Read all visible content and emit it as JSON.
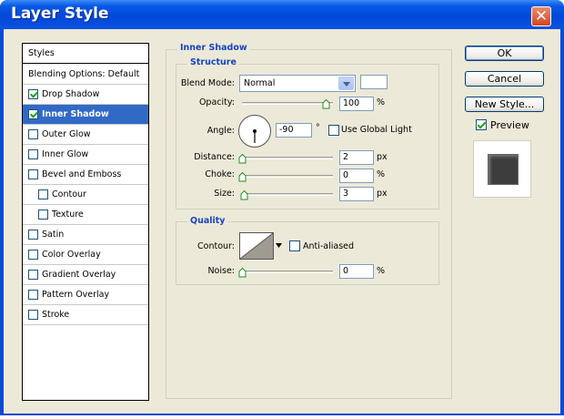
{
  "window": {
    "title": "Layer Style",
    "close_glyph": "✕"
  },
  "sidebar": {
    "header": "Styles",
    "items": [
      {
        "label": "Blending Options: Default",
        "checkbox": false,
        "checked": false,
        "indent": false
      },
      {
        "label": "Drop Shadow",
        "checkbox": true,
        "checked": true,
        "indent": false
      },
      {
        "label": "Inner Shadow",
        "checkbox": true,
        "checked": true,
        "indent": false,
        "selected": true
      },
      {
        "label": "Outer Glow",
        "checkbox": true,
        "checked": false,
        "indent": false
      },
      {
        "label": "Inner Glow",
        "checkbox": true,
        "checked": false,
        "indent": false
      },
      {
        "label": "Bevel and Emboss",
        "checkbox": true,
        "checked": false,
        "indent": false
      },
      {
        "label": "Contour",
        "checkbox": true,
        "checked": false,
        "indent": true
      },
      {
        "label": "Texture",
        "checkbox": true,
        "checked": false,
        "indent": true
      },
      {
        "label": "Satin",
        "checkbox": true,
        "checked": false,
        "indent": false
      },
      {
        "label": "Color Overlay",
        "checkbox": true,
        "checked": false,
        "indent": false
      },
      {
        "label": "Gradient Overlay",
        "checkbox": true,
        "checked": false,
        "indent": false
      },
      {
        "label": "Pattern Overlay",
        "checkbox": true,
        "checked": false,
        "indent": false
      },
      {
        "label": "Stroke",
        "checkbox": true,
        "checked": false,
        "indent": false
      }
    ]
  },
  "panel": {
    "title": "Inner Shadow",
    "structure": {
      "title": "Structure",
      "blend_mode_label": "Blend Mode:",
      "blend_mode_value": "Normal",
      "opacity_label": "Opacity:",
      "opacity_value": "100",
      "opacity_level": 100,
      "opacity_unit": "%",
      "angle_label": "Angle:",
      "angle_value": "-90",
      "angle_unit": "°",
      "use_global_light_label": "Use Global Light",
      "use_global_light_checked": false,
      "distance_label": "Distance:",
      "distance_value": "2",
      "distance_unit": "px",
      "choke_label": "Choke:",
      "choke_value": "0",
      "choke_unit": "%",
      "size_label": "Size:",
      "size_value": "3",
      "size_unit": "px"
    },
    "quality": {
      "title": "Quality",
      "contour_label": "Contour:",
      "anti_aliased_label": "Anti-aliased",
      "anti_aliased_checked": false,
      "noise_label": "Noise:",
      "noise_value": "0",
      "noise_unit": "%"
    }
  },
  "buttons": {
    "ok": "OK",
    "cancel": "Cancel",
    "new_style": "New Style...",
    "preview_label": "Preview",
    "preview_checked": true
  },
  "colors": {
    "title_bar": "#0a4ad8",
    "selection": "#316ac5",
    "group_title": "#1845c0",
    "dialog_bg": "#ece9d8",
    "close_button": "#d2461f"
  }
}
